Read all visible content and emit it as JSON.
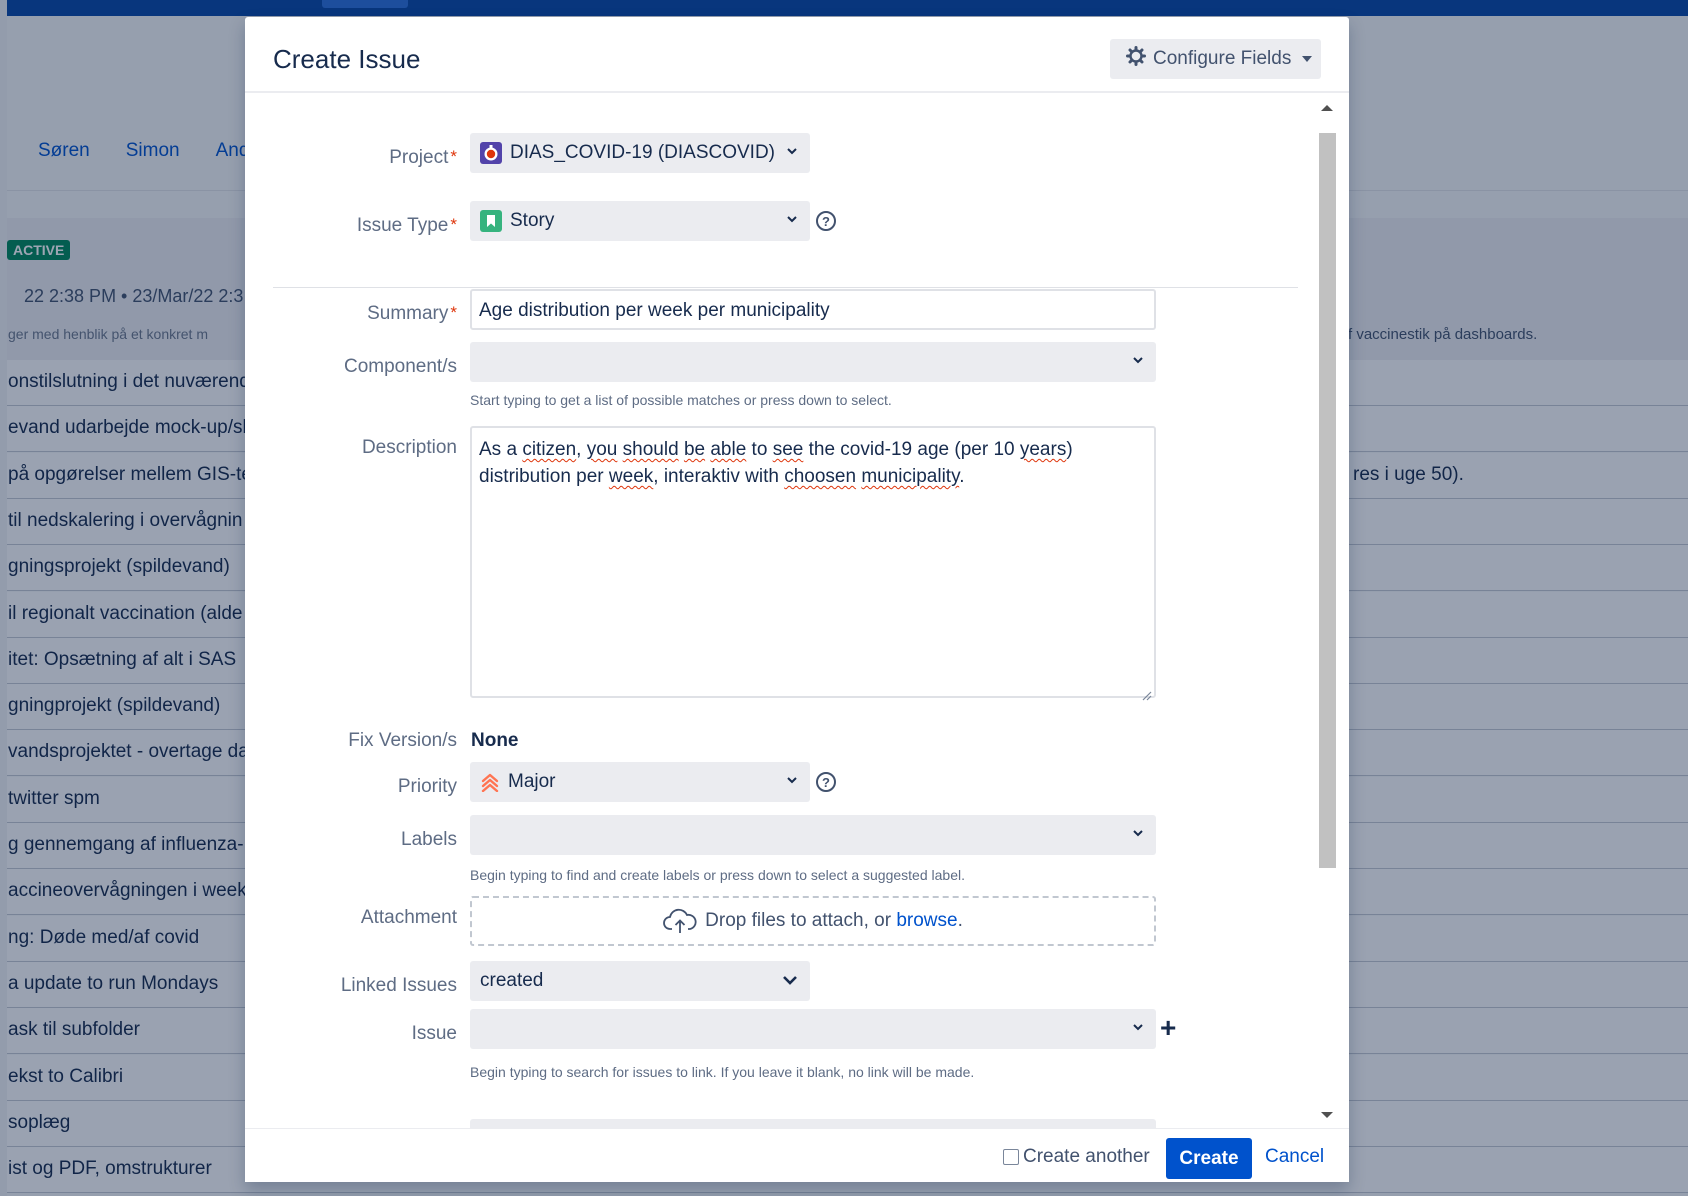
{
  "background": {
    "users": [
      "Søren",
      "Simon",
      "And"
    ],
    "sprint_badge": "ACTIVE",
    "sprint_dates": "22 2:38 PM  •  23/Mar/22 2:3",
    "sprint_goal_left": "ger med henblik på et konkret m",
    "sprint_goal_right": "f vaccinestik på dashboards.",
    "rows": [
      {
        "text": "onstilslutning i det nuværend",
        "right": ""
      },
      {
        "text": "evand udarbejde mock-up/sl",
        "right": ""
      },
      {
        "text": "på opgørelser mellem GIS-te",
        "right": "res i uge 50)."
      },
      {
        "text": "til nedskalering i overvågnin",
        "right": ""
      },
      {
        "text": "gningsprojekt (spildevand)",
        "right": ""
      },
      {
        "text": "il regionalt vaccination (alde",
        "right": ""
      },
      {
        "text": "itet: Opsætning af alt i SAS",
        "right": ""
      },
      {
        "text": "gningprojekt (spildevand)",
        "right": ""
      },
      {
        "text": "vandsprojektet - overtage da",
        "right": ""
      },
      {
        "text": "twitter spm",
        "right": ""
      },
      {
        "text": "g gennemgang af influenza-",
        "right": ""
      },
      {
        "text": "accineovervågningen i weeke",
        "right": ""
      },
      {
        "text": "ng: Døde med/af covid",
        "right": ""
      },
      {
        "text": "a update to run Mondays",
        "right": ""
      },
      {
        "text": "ask til subfolder",
        "right": ""
      },
      {
        "text": "ekst to Calibri",
        "right": ""
      },
      {
        "text": "soplæg",
        "right": ""
      },
      {
        "text": "ist og PDF, omstrukturer",
        "right": ""
      }
    ]
  },
  "modal": {
    "title": "Create Issue",
    "configure_fields": "Configure Fields",
    "fields": {
      "project": {
        "label": "Project",
        "value": "DIAS_COVID-19 (DIASCOVID)",
        "icon": "project-avatar-icon"
      },
      "issue_type": {
        "label": "Issue Type",
        "value": "Story",
        "icon": "story-icon"
      },
      "summary": {
        "label": "Summary",
        "value": "Age distribution per week per municipality"
      },
      "components": {
        "label": "Component/s",
        "value": "",
        "hint": "Start typing to get a list of possible matches or press down to select."
      },
      "description": {
        "label": "Description",
        "line1": [
          "As a ",
          "citizen",
          ", ",
          "you",
          " ",
          "should",
          " ",
          "be",
          " ",
          "able",
          " to ",
          "see",
          " the covid-19 age (per 10 ",
          "years",
          ")"
        ],
        "line2": [
          "distribution per ",
          "week",
          ", interaktiv with ",
          "choosen",
          " ",
          "municipality",
          "."
        ]
      },
      "fix_versions": {
        "label": "Fix Version/s",
        "value": "None"
      },
      "priority": {
        "label": "Priority",
        "value": "Major",
        "icon": "priority-major-icon"
      },
      "labels": {
        "label": "Labels",
        "value": "",
        "hint": "Begin typing to find and create labels or press down to select a suggested label."
      },
      "attachment": {
        "label": "Attachment",
        "drop_text": "Drop files to attach, or ",
        "browse": "browse",
        "after": "."
      },
      "linked_issues": {
        "label": "Linked Issues",
        "value": "created"
      },
      "issue": {
        "label": "Issue",
        "value": "",
        "hint": "Begin typing to search for issues to link. If you leave it blank, no link will be made."
      }
    },
    "footer": {
      "create_another": "Create another",
      "create": "Create",
      "cancel": "Cancel"
    }
  },
  "colors": {
    "primary": "#0052cc",
    "required": "#de350b",
    "story": "#36b37e",
    "priority_major": "#ff7452",
    "active_badge": "#00875a"
  }
}
